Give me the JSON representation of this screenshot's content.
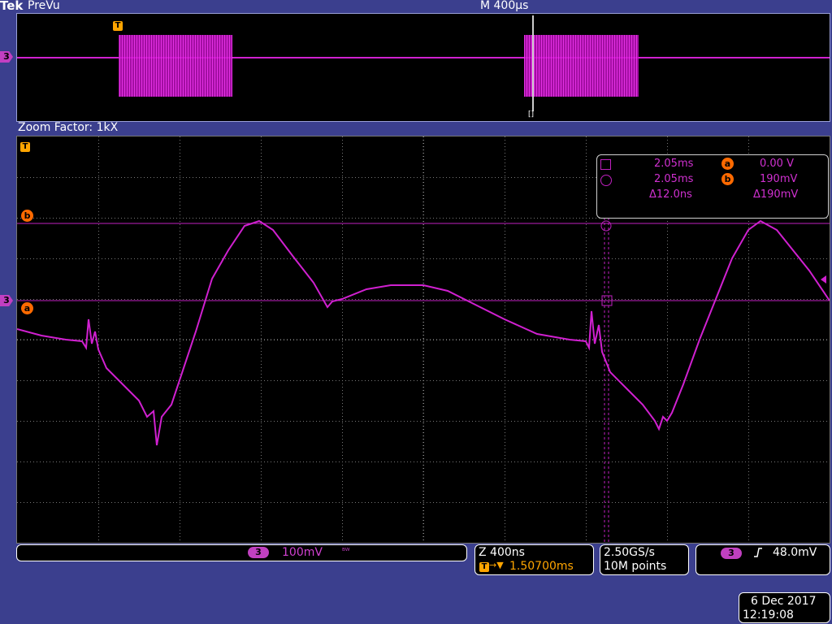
{
  "header": {
    "brand": "Tek",
    "mode": "PreVu",
    "timebase": "M 400µs"
  },
  "overview": {
    "channel_marker": "3",
    "trigger_marker": "T",
    "view_marker": "[]"
  },
  "zoom": {
    "factor_label": "Zoom Factor: 1kX",
    "trigger_marker": "T",
    "cursor_b_label": "b",
    "cursor_a_label": "a",
    "channel_marker": "3"
  },
  "cursor_readout": {
    "row1_time": "2.05ms",
    "row1_cursor": "a",
    "row1_value": "0.00 V",
    "row2_time": "2.05ms",
    "row2_cursor": "b",
    "row2_value": "190mV",
    "delta_time": "Δ12.0ns",
    "delta_value": "Δ190mV"
  },
  "status": {
    "channel": "3",
    "volts_per_div": "100mV",
    "bw_icon": "bw-limit-icon",
    "zoom_time": "Z 400ns",
    "trigger_pos_label": "T",
    "trigger_pos_arrow": "→▼",
    "trigger_pos": "1.50700ms",
    "sample_rate": "2.50GS/s",
    "record_length": "10M points",
    "trig_channel": "3",
    "trig_slope": "rising-edge-icon",
    "trig_level": "48.0mV"
  },
  "datetime": {
    "date": "6 Dec  2017",
    "time": "12:19:08"
  },
  "colors": {
    "background": "#3b3f8e",
    "waveform": "#d020d0",
    "accent": "#ff6a00",
    "trigger": "#ffa500"
  }
}
